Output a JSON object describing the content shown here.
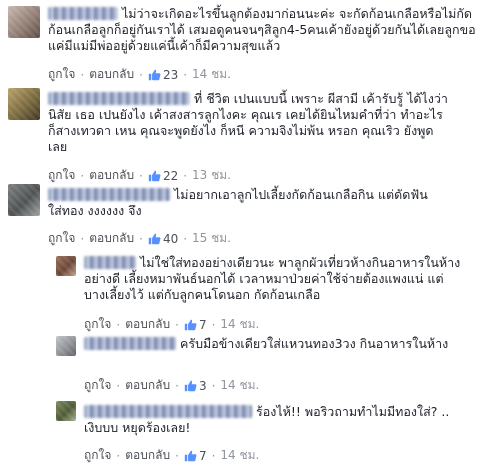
{
  "comments": [
    {
      "text": "ไม่ว่าจะเกิดอะไรขึ้นลูกต้องมาก่อนนะค่ะ จะกัดก้อนเกลือหรือไม่กัดก้อนเกลือลูกก็อยู่กันเราได้ เสมอดูคนจนๆสิลูก4-5คนเค้ายังอยู่ด้วยกันได้เลยลูกขอแค่มีแม่มีพ่ออยู่ด้วยแค่นี้เค้าก็มีความสุขแล้ว",
      "like_label": "ถูกใจ",
      "reply_label": "ตอบกลับ",
      "like_count": "23",
      "time": "14 ชม."
    },
    {
      "text": "ที่ ชีวิต เปนแบบนี้ เพราะ ผีสามี เค้ารับรู้ ได้ไงว่า นิสัย เธอ เปนยังไง เค้าสงสารลูกไงคะ คุณเร เคยได้ยินไหมคำที่ว่า ทำอะไรก็สางเทวดา เหน คุณจะพูดยังไง ก็หนี ความจิงไม่พ้น หรอก คุณเริว ยังพูดเลย",
      "like_label": "ถูกใจ",
      "reply_label": "ตอบกลับ",
      "like_count": "22",
      "time": "13 ชม."
    },
    {
      "text": "ไม่อยากเอาลูกไปเลี้ยงกัดก้อนเกลือกิน แต่ดัดฟัน ใส่ทอง งงงงงง จึง",
      "like_label": "ถูกใจ",
      "reply_label": "ตอบกลับ",
      "like_count": "40",
      "time": "15 ชม."
    }
  ],
  "replies": [
    {
      "text": "ไม่ใช่ใส่ทองอย่างเดียวนะ พาลูกผัวเที่ยวห้างกินอาหารในห้างอย่างดี เลี้ยงหมาพันธ์นอกได้ เวลาหมาป่วยค่าใช้จ่ายต้องแพงแน่ แต่บางเลี้ยงไว้ แต่กับลูกคนโดนอก กัดก้อนเกลือ",
      "like_label": "ถูกใจ",
      "reply_label": "ตอบกลับ",
      "like_count": "7",
      "time": "14 ชม."
    },
    {
      "text": "ครับมือข้างเดียวใส่แหวนทอง3วง กินอาหารในห้าง",
      "like_label": "ถูกใจ",
      "reply_label": "ตอบกลับ",
      "like_count": "3",
      "time": "14 ชม."
    },
    {
      "text": "ร้องไห้!! พอริวถามทำไมมีทองใส่? .. เงิบบบ หยุดร้องเลย!",
      "like_label": "ถูกใจ",
      "reply_label": "ตอบกลับ",
      "like_count": "7",
      "time": "14 ชม."
    }
  ],
  "colors": {
    "link": "#365899",
    "meta": "#90949c",
    "text": "#1d2129"
  },
  "icons": {
    "like": "thumbs-up-icon"
  }
}
